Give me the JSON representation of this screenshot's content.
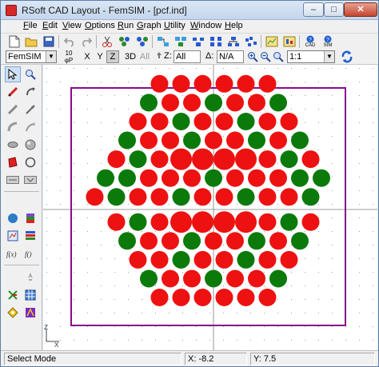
{
  "window": {
    "title": "RSoft CAD Layout - FemSIM - [pcf.ind]",
    "min": "–",
    "max": "□",
    "close": "✕"
  },
  "menu": [
    "File",
    "Edit",
    "View",
    "Options",
    "Run",
    "Graph",
    "Utility",
    "Window",
    "Help"
  ],
  "toolbar1": {
    "icons": [
      "new-file-icon",
      "open-folder-icon",
      "save-icon",
      "undo-icon",
      "redo-icon",
      "pointer-icon",
      "cut-icon",
      "copy-icon",
      "paste-icon",
      "group-icon",
      "ungroup-icon",
      "align-icon",
      "arrange-icon",
      "hierarchy-icon",
      "chart-icon",
      "chart2-icon",
      "tools-icon",
      "cad-help-icon",
      "sim-help-icon"
    ],
    "cad_help_label": "CAD",
    "sim_help_label": "SIM"
  },
  "toolbar2": {
    "simulator": "FemSIM",
    "view_labels": {
      "top": "10",
      "bottom": "φP"
    },
    "axes": [
      "X",
      "Y",
      "Z"
    ],
    "active_axis": "Z",
    "mode_3d": "3D",
    "all": "All",
    "z_label": "Z:",
    "z_value": "All",
    "delta_label": "Δ:",
    "delta_value": "N/A",
    "zoom_ratio": "1:1"
  },
  "palette": {
    "icons": [
      "select-arrow-icon",
      "zoom-icon",
      "segment-icon",
      "rotate-icon",
      "line-icon",
      "arrow-icon",
      "arc-icon",
      "curved-arrow-icon",
      "ellipse-icon",
      "sphere-icon",
      "polygon-icon",
      "circle-icon",
      "text-label-icon",
      "variable-icon",
      "globe-icon",
      "layers-icon",
      "field-monitor-icon",
      "stack-icon",
      "function-icon",
      "function2-icon",
      "launch-icon",
      "network-icon",
      "grid-icon",
      "aperture-icon",
      "compass-icon"
    ]
  },
  "canvas": {
    "colors": {
      "red": "#ee1111",
      "green": "#0b7a0b",
      "boundary": "#8a0a8a",
      "grid": "#9a9a9a",
      "axis": "#7a7a7a"
    },
    "rows": [
      {
        "y": 6.0,
        "xs": [
          -2.5,
          -1.5,
          -0.5,
          0.5,
          1.5,
          2.5
        ],
        "big": [
          0,
          0,
          0,
          0,
          0,
          0
        ],
        "colors": "RRRRRR"
      },
      {
        "y": 5.1,
        "xs": [
          -3,
          -2,
          -1,
          0,
          1,
          2,
          3
        ],
        "big": [
          0,
          0,
          0,
          0,
          0,
          0,
          0
        ],
        "colors": "GRRGRRG"
      },
      {
        "y": 4.2,
        "xs": [
          -3.5,
          -2.5,
          -1.5,
          -0.5,
          0.5,
          1.5,
          2.5,
          3.5
        ],
        "big": [
          0,
          0,
          0,
          0,
          0,
          0,
          0,
          0
        ],
        "colors": "RRGRRGRR"
      },
      {
        "y": 3.3,
        "xs": [
          -4,
          -3,
          -2,
          -1,
          0,
          1,
          2,
          3,
          4
        ],
        "big": [
          0,
          0,
          0,
          0,
          0,
          0,
          0,
          0,
          0
        ],
        "colors": "GRRGRRGRG"
      },
      {
        "y": 2.4,
        "xs": [
          -4.5,
          -3.5,
          -2.5,
          -1.5,
          -0.5,
          0.5,
          1.5,
          2.5,
          3.5,
          4.5
        ],
        "big": [
          0,
          0,
          0,
          1,
          1,
          1,
          1,
          0,
          0,
          0
        ],
        "colors": "RGRRRRRRGR"
      },
      {
        "y": 1.5,
        "xs": [
          -5,
          -4,
          -3,
          -2,
          -1,
          0,
          1,
          2,
          3,
          4,
          5
        ],
        "big": [
          0,
          0,
          0,
          0,
          0,
          0,
          0,
          0,
          0,
          0,
          0
        ],
        "colors": "GGRRRGRRRGG"
      },
      {
        "y": 0.6,
        "xs": [
          -5.5,
          -4.5,
          -3.5,
          -2.5,
          -1.5,
          -0.5,
          0.5,
          1.5,
          2.5,
          3.5,
          4.5
        ],
        "big": [
          0,
          0,
          0,
          0,
          0,
          0,
          0,
          0,
          0,
          0,
          0
        ],
        "colors": "RGRRGRRGRRG"
      },
      {
        "y": -0.6,
        "xs": [
          -4.5,
          -3.5,
          -2.5,
          -1.5,
          -0.5,
          0.5,
          1.5,
          2.5,
          3.5,
          4.5
        ],
        "big": [
          0,
          0,
          0,
          1,
          1,
          1,
          1,
          0,
          0,
          0
        ],
        "colors": "RGRRRRRRGR"
      },
      {
        "y": -1.5,
        "xs": [
          -4,
          -3,
          -2,
          -1,
          0,
          1,
          2,
          3,
          4
        ],
        "big": [
          0,
          0,
          0,
          0,
          0,
          0,
          0,
          0,
          0
        ],
        "colors": "GRRGRRGRG"
      },
      {
        "y": -2.4,
        "xs": [
          -3.5,
          -2.5,
          -1.5,
          -0.5,
          0.5,
          1.5,
          2.5,
          3.5
        ],
        "big": [
          0,
          0,
          0,
          0,
          0,
          0,
          0,
          0
        ],
        "colors": "RRGRRGRR"
      },
      {
        "y": -3.3,
        "xs": [
          -3,
          -2,
          -1,
          0,
          1,
          2,
          3
        ],
        "big": [
          0,
          0,
          0,
          0,
          0,
          0,
          0
        ],
        "colors": "GRRGRRG"
      },
      {
        "y": -4.2,
        "xs": [
          -2.5,
          -1.5,
          -0.5,
          0.5,
          1.5,
          2.5
        ],
        "big": [
          0,
          0,
          0,
          0,
          0,
          0
        ],
        "colors": "RRRRRR"
      }
    ],
    "axis_origin_label": "Z",
    "axis_x_label": "X"
  },
  "status": {
    "mode": "Select Mode",
    "x": "X: -8.2",
    "y": "Y: 7.5"
  }
}
